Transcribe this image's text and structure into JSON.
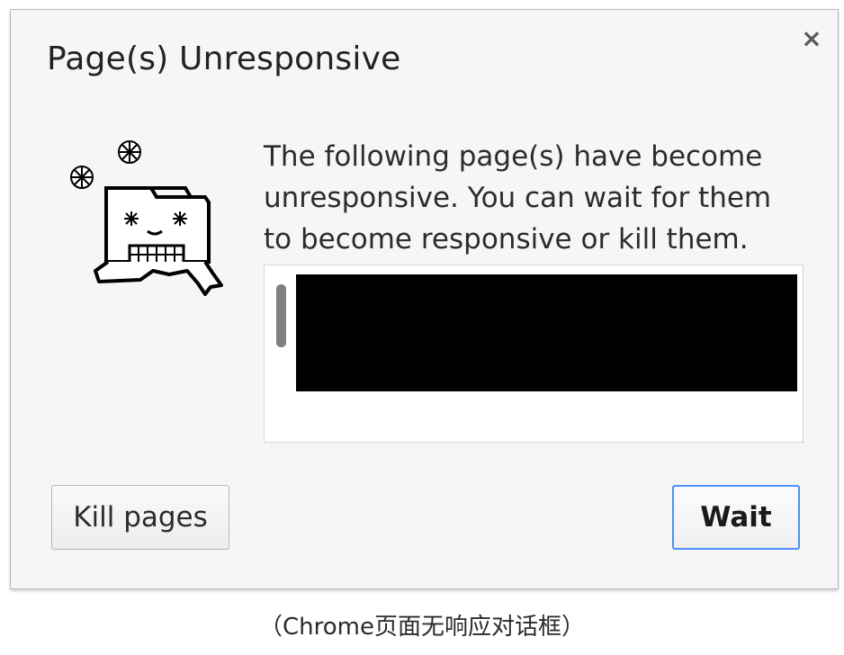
{
  "dialog": {
    "title": "Page(s) Unresponsive",
    "close_glyph": "×",
    "mascot_icon": "frozen-tab-icon",
    "message": "The following page(s) have become unresponsive. You can wait for them to become responsive or kill them.",
    "page_list": {
      "items": [
        "[redacted]"
      ]
    },
    "buttons": {
      "kill": "Kill pages",
      "wait": "Wait"
    },
    "focus_color": "#4d90fe"
  },
  "caption": "（Chrome页面无响应对话框）"
}
